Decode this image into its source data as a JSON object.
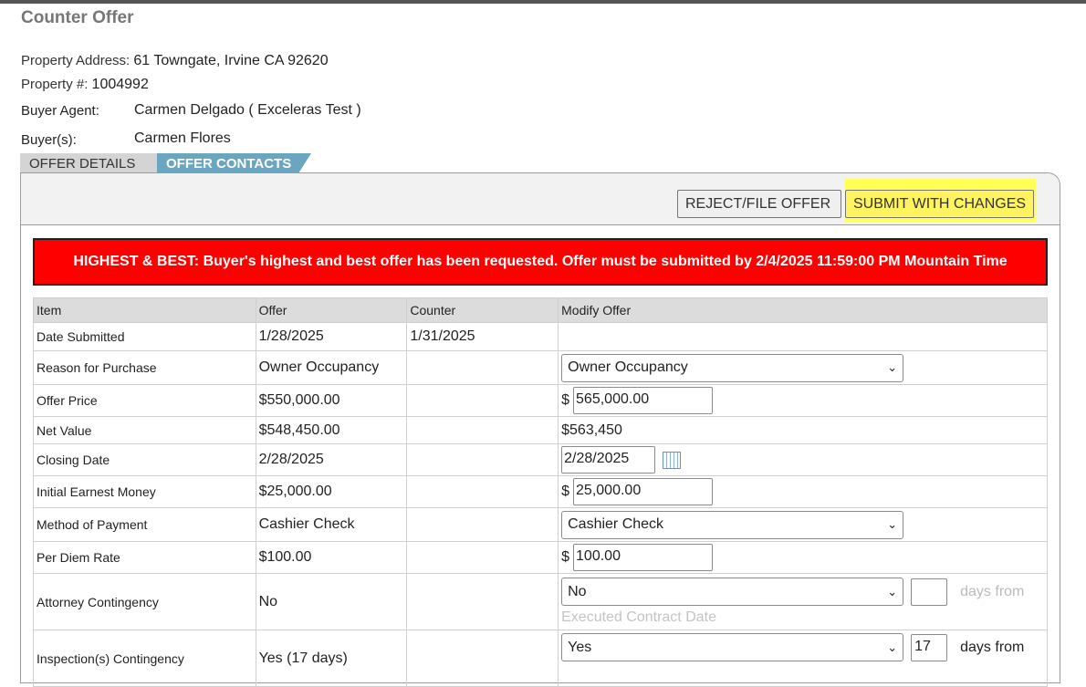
{
  "page": {
    "title": "Counter Offer"
  },
  "property": {
    "address_label": "Property Address:",
    "address": "61 Towngate, Irvine CA 92620",
    "number_label": "Property #:",
    "number": "1004992"
  },
  "buyer_agent": {
    "label": "Buyer Agent:",
    "value": "Carmen Delgado ( Exceleras Test )"
  },
  "buyers": {
    "label": "Buyer(s):",
    "value": "Carmen Flores"
  },
  "tabs": [
    {
      "label": "OFFER DETAILS"
    },
    {
      "label": "OFFER CONTACTS"
    }
  ],
  "toolbar": {
    "reject_label": "REJECT/FILE OFFER",
    "submit_label": "SUBMIT WITH CHANGES"
  },
  "alert": {
    "text": "HIGHEST & BEST: Buyer's highest and best offer has been requested. Offer must be submitted by 2/4/2025 11:59:00 PM Mountain Time"
  },
  "table": {
    "headers": [
      "Item",
      "Offer",
      "Counter",
      "Modify Offer"
    ],
    "rows": {
      "date_submitted": {
        "item": "Date Submitted",
        "offer": "1/28/2025",
        "counter": "1/31/2025"
      },
      "reason": {
        "item": "Reason for Purchase",
        "offer": "Owner Occupancy",
        "modify": "Owner Occupancy"
      },
      "offer_price": {
        "item": "Offer Price",
        "offer": "$550,000.00",
        "currency": "$",
        "modify": "565,000.00"
      },
      "net_value": {
        "item": "Net Value",
        "offer": "$548,450.00",
        "modify": "$563,450"
      },
      "closing_date": {
        "item": "Closing Date",
        "offer": "2/28/2025",
        "modify": "2/28/2025"
      },
      "earnest": {
        "item": "Initial Earnest Money",
        "offer": "$25,000.00",
        "currency": "$",
        "modify": "25,000.00"
      },
      "payment": {
        "item": "Method of Payment",
        "offer": "Cashier Check",
        "modify": "Cashier Check"
      },
      "per_diem": {
        "item": "Per Diem Rate",
        "offer": "$100.00",
        "currency": "$",
        "modify": "100.00"
      },
      "attorney": {
        "item": "Attorney Contingency",
        "offer": "No",
        "modify": "No",
        "days": "",
        "days_from": "days from",
        "executed": "Executed Contract Date"
      },
      "inspection": {
        "item": "Inspection(s) Contingency",
        "offer": "Yes (17 days)",
        "modify": "Yes",
        "days": "17",
        "days_from": "days from"
      }
    }
  },
  "colors": {
    "alert_bg": "#ff0000",
    "tab_active": "#6aa6bf",
    "submit_highlight": "#ffff55"
  }
}
